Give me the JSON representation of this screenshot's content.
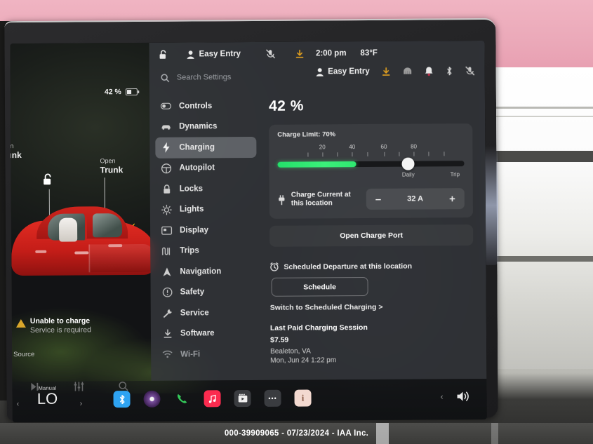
{
  "status_bar": {
    "battery_percent": "42 %",
    "lock_icon": "unlocked-icon",
    "profile_icon": "person-icon",
    "profile_name": "Easy Entry",
    "mute_icon": "microphone-muted-icon",
    "download_icon": "software-update-icon",
    "time": "2:00 pm",
    "temperature": "83°F"
  },
  "vehicle_view": {
    "frunk_sub": "Open",
    "frunk_main": "Frunk",
    "trunk_sub": "Open",
    "trunk_main": "Trunk",
    "lock_icon": "unlocked-padlock-icon",
    "charge_bolt_icon": "lightning-bolt-icon",
    "warning_title": "Unable to charge",
    "warning_subtitle": "Service is required",
    "source_label": "Source",
    "media_icons": [
      "skip-next-icon",
      "equalizer-icon",
      "search-icon"
    ]
  },
  "settings": {
    "search_placeholder": "Search Settings",
    "search_icon": "search-icon",
    "top_profile": "Easy Entry",
    "top_icons": [
      "person-icon",
      "software-update-icon",
      "car-icon",
      "bell-icon",
      "bluetooth-icon",
      "microphone-muted-icon"
    ],
    "sidebar": [
      {
        "label": "Controls",
        "icon": "toggle-icon",
        "state": "normal"
      },
      {
        "label": "Dynamics",
        "icon": "car-icon",
        "state": "normal"
      },
      {
        "label": "Charging",
        "icon": "bolt-icon",
        "state": "active"
      },
      {
        "label": "Autopilot",
        "icon": "steering-wheel-icon",
        "state": "normal"
      },
      {
        "label": "Locks",
        "icon": "padlock-icon",
        "state": "normal"
      },
      {
        "label": "Lights",
        "icon": "sun-icon",
        "state": "normal"
      },
      {
        "label": "Display",
        "icon": "screen-icon",
        "state": "normal"
      },
      {
        "label": "Trips",
        "icon": "route-icon",
        "state": "normal"
      },
      {
        "label": "Navigation",
        "icon": "navigation-arrow-icon",
        "state": "normal"
      },
      {
        "label": "Safety",
        "icon": "alert-circle-icon",
        "state": "normal"
      },
      {
        "label": "Service",
        "icon": "wrench-icon",
        "state": "normal"
      },
      {
        "label": "Software",
        "icon": "download-icon",
        "state": "normal"
      },
      {
        "label": "Wi-Fi",
        "icon": "wifi-icon",
        "state": "dim"
      }
    ],
    "charging": {
      "battery_percent": "42 %",
      "charge_limit_label": "Charge Limit: 70%",
      "open_charge_port": "Open Charge Port",
      "scheduled_departure_label": "Scheduled Departure at this location",
      "scheduled_departure_icon": "alarm-clock-icon",
      "schedule_button": "Schedule",
      "switch_link": "Switch to Scheduled Charging >",
      "charge_current_label_line1": "Charge Current at",
      "charge_current_label_line2": "this location",
      "charge_current_icon": "charge-plug-icon",
      "charge_current_value": "32 A",
      "minus_label": "–",
      "plus_label": "+",
      "last_paid_heading": "Last Paid Charging Session",
      "last_paid_amount": "$7.59",
      "last_paid_location": "Bealeton, VA",
      "last_paid_date": "Mon, Jun 24 1:22 pm",
      "accent_green": "#2fe870"
    }
  },
  "charge_slider": {
    "tick_labels": [
      "20",
      "40",
      "60",
      "80"
    ],
    "tick_positions_pct": [
      24,
      40,
      57,
      73
    ],
    "current_fill_pct": 42,
    "limit_pct": 70,
    "daily_label": "Daily",
    "trip_label": "Trip",
    "daily_pos_pct": 70,
    "trip_pos_pct": 95
  },
  "taskbar": {
    "climate_mode": "Manual",
    "climate_temp": "LO",
    "left_chevron": "‹",
    "right_chevron": "›",
    "apps": [
      {
        "name": "bluetooth-app-icon",
        "glyph": "ᛦ"
      },
      {
        "name": "media-disc-icon",
        "glyph": ""
      },
      {
        "name": "phone-icon",
        "glyph": "✆"
      },
      {
        "name": "music-app-icon",
        "glyph": "♫"
      },
      {
        "name": "video-app-icon",
        "glyph": "▶"
      },
      {
        "name": "more-apps-icon",
        "glyph": "•••"
      },
      {
        "name": "info-card-icon",
        "glyph": "i"
      }
    ],
    "volume_icon": "speaker-volume-icon",
    "volume_chevron": "‹"
  },
  "footer": {
    "watermark": "000-39909065 - 07/23/2024 - IAA Inc."
  }
}
